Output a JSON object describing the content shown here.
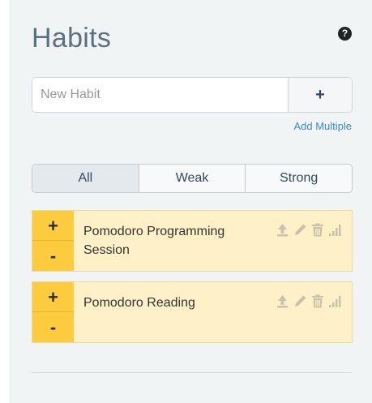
{
  "panel": {
    "title": "Habits",
    "help_label": "?"
  },
  "new_habit": {
    "placeholder": "New Habit",
    "value": "",
    "add_label": "+"
  },
  "add_multiple_label": "Add Multiple",
  "filters": [
    "All",
    "Weak",
    "Strong"
  ],
  "filter_selected": "All",
  "habits": [
    {
      "name": "Pomodoro Programming Session",
      "plus": "+",
      "minus": "-"
    },
    {
      "name": "Pomodoro Reading",
      "plus": "+",
      "minus": "-"
    }
  ],
  "icons": [
    "push-to-top-icon",
    "edit-pencil-icon",
    "trash-icon",
    "stats-bars-icon"
  ],
  "colors": {
    "panel_bg": "#f1f4f5",
    "habit_bg": "#fff1c7",
    "habit_control": "#fdcb3e",
    "title": "#5b7180",
    "link": "#3d8bd1"
  }
}
